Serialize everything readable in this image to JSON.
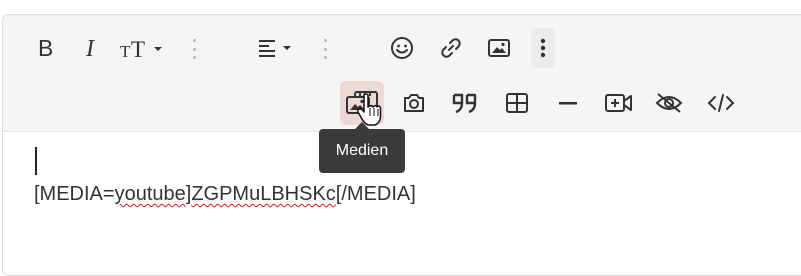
{
  "toolbar": {
    "row1": [
      {
        "name": "bold-button",
        "icon": "bold-icon"
      },
      {
        "name": "italic-button",
        "icon": "italic-icon"
      },
      {
        "name": "font-size-button",
        "icon": "font-size-icon"
      },
      {
        "name": "align-button",
        "icon": "align-left-icon"
      },
      {
        "name": "emoji-button",
        "icon": "smiley-icon"
      },
      {
        "name": "link-button",
        "icon": "link-icon"
      },
      {
        "name": "image-button",
        "icon": "image-icon"
      },
      {
        "name": "more-options-button",
        "icon": "vertical-ellipsis-icon"
      }
    ],
    "row2": [
      {
        "name": "media-button",
        "icon": "media-icon",
        "state": "hovered"
      },
      {
        "name": "camera-button",
        "icon": "camera-icon"
      },
      {
        "name": "quote-button",
        "icon": "quote-icon"
      },
      {
        "name": "table-button",
        "icon": "table-icon"
      },
      {
        "name": "horizontal-rule-button",
        "icon": "minus-icon"
      },
      {
        "name": "video-button",
        "icon": "video-plus-icon"
      },
      {
        "name": "spoiler-button",
        "icon": "eye-slash-icon"
      },
      {
        "name": "code-button",
        "icon": "code-icon"
      }
    ]
  },
  "tooltip": {
    "text": "Medien"
  },
  "editor": {
    "text_prefix": "[MEDIA=",
    "text_word1": "youtube",
    "text_mid": "]",
    "text_word2": "ZGPMuLBHSKc",
    "text_suffix": "[/MEDIA]"
  },
  "colors": {
    "toolbar_bg": "#f5f5f5",
    "hover_bg": "#ecd9d6",
    "tooltip_bg": "#3a3a3a",
    "spell_error": "#d12"
  }
}
